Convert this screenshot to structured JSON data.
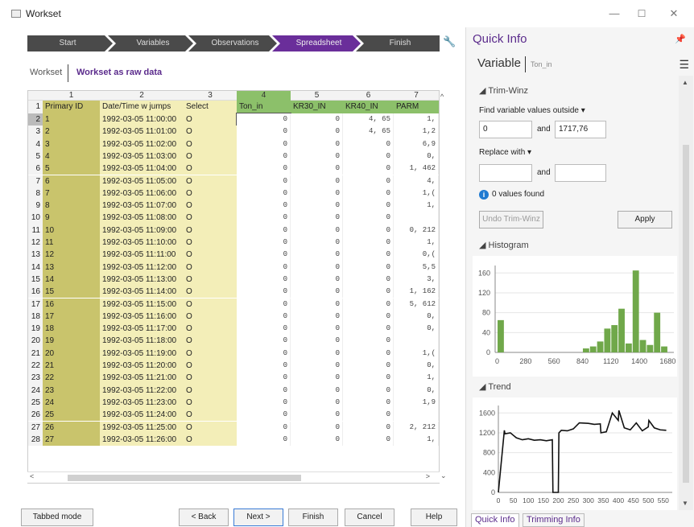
{
  "window": {
    "title": "Workset"
  },
  "wizard": {
    "steps": [
      "Start",
      "Variables",
      "Observations",
      "Spreadsheet",
      "Finish"
    ],
    "active": 3
  },
  "tabs": {
    "workset": "Workset",
    "raw": "Workset as raw data"
  },
  "grid": {
    "col_numbers": [
      "1",
      "2",
      "3",
      "4",
      "5",
      "6",
      "7"
    ],
    "headers": [
      "Primary ID",
      "Date/Time w jumps",
      "Select",
      "Ton_in",
      "KR30_IN",
      "KR40_IN",
      "PARM"
    ],
    "rows": [
      {
        "n": "2",
        "id": "1",
        "dt": "1992-03-05 11:00:00",
        "sel": "O",
        "ton": "0",
        "kr30": "0",
        "kr40": "4, 65",
        "parm": "1,"
      },
      {
        "n": "3",
        "id": "2",
        "dt": "1992-03-05 11:01:00",
        "sel": "O",
        "ton": "0",
        "kr30": "0",
        "kr40": "4, 65",
        "parm": "1,2"
      },
      {
        "n": "4",
        "id": "3",
        "dt": "1992-03-05 11:02:00",
        "sel": "O",
        "ton": "0",
        "kr30": "0",
        "kr40": "0",
        "parm": "6,9"
      },
      {
        "n": "5",
        "id": "4",
        "dt": "1992-03-05 11:03:00",
        "sel": "O",
        "ton": "0",
        "kr30": "0",
        "kr40": "0",
        "parm": "0,"
      },
      {
        "n": "6",
        "id": "5",
        "dt": "1992-03-05 11:04:00",
        "sel": "O",
        "ton": "0",
        "kr30": "0",
        "kr40": "0",
        "parm": "1, 462"
      },
      {
        "n": "7",
        "id": "6",
        "dt": "1992-03-05 11:05:00",
        "sel": "O",
        "ton": "0",
        "kr30": "0",
        "kr40": "0",
        "parm": "4,"
      },
      {
        "n": "8",
        "id": "7",
        "dt": "1992-03-05 11:06:00",
        "sel": "O",
        "ton": "0",
        "kr30": "0",
        "kr40": "0",
        "parm": "1,("
      },
      {
        "n": "9",
        "id": "8",
        "dt": "1992-03-05 11:07:00",
        "sel": "O",
        "ton": "0",
        "kr30": "0",
        "kr40": "0",
        "parm": "1,"
      },
      {
        "n": "10",
        "id": "9",
        "dt": "1992-03-05 11:08:00",
        "sel": "O",
        "ton": "0",
        "kr30": "0",
        "kr40": "0",
        "parm": ""
      },
      {
        "n": "11",
        "id": "10",
        "dt": "1992-03-05 11:09:00",
        "sel": "O",
        "ton": "0",
        "kr30": "0",
        "kr40": "0",
        "parm": "0, 212"
      },
      {
        "n": "12",
        "id": "11",
        "dt": "1992-03-05 11:10:00",
        "sel": "O",
        "ton": "0",
        "kr30": "0",
        "kr40": "0",
        "parm": "1,"
      },
      {
        "n": "13",
        "id": "12",
        "dt": "1992-03-05 11:11:00",
        "sel": "O",
        "ton": "0",
        "kr30": "0",
        "kr40": "0",
        "parm": "0,("
      },
      {
        "n": "14",
        "id": "13",
        "dt": "1992-03-05 11:12:00",
        "sel": "O",
        "ton": "0",
        "kr30": "0",
        "kr40": "0",
        "parm": "5,5"
      },
      {
        "n": "15",
        "id": "14",
        "dt": "1992-03-05 11:13:00",
        "sel": "O",
        "ton": "0",
        "kr30": "0",
        "kr40": "0",
        "parm": "3,"
      },
      {
        "n": "16",
        "id": "15",
        "dt": "1992-03-05 11:14:00",
        "sel": "O",
        "ton": "0",
        "kr30": "0",
        "kr40": "0",
        "parm": "1, 162"
      },
      {
        "n": "17",
        "id": "16",
        "dt": "1992-03-05 11:15:00",
        "sel": "O",
        "ton": "0",
        "kr30": "0",
        "kr40": "0",
        "parm": "5, 612"
      },
      {
        "n": "18",
        "id": "17",
        "dt": "1992-03-05 11:16:00",
        "sel": "O",
        "ton": "0",
        "kr30": "0",
        "kr40": "0",
        "parm": "0,"
      },
      {
        "n": "19",
        "id": "18",
        "dt": "1992-03-05 11:17:00",
        "sel": "O",
        "ton": "0",
        "kr30": "0",
        "kr40": "0",
        "parm": "0,"
      },
      {
        "n": "20",
        "id": "19",
        "dt": "1992-03-05 11:18:00",
        "sel": "O",
        "ton": "0",
        "kr30": "0",
        "kr40": "0",
        "parm": ""
      },
      {
        "n": "21",
        "id": "20",
        "dt": "1992-03-05 11:19:00",
        "sel": "O",
        "ton": "0",
        "kr30": "0",
        "kr40": "0",
        "parm": "1,("
      },
      {
        "n": "22",
        "id": "21",
        "dt": "1992-03-05 11:20:00",
        "sel": "O",
        "ton": "0",
        "kr30": "0",
        "kr40": "0",
        "parm": "0,"
      },
      {
        "n": "23",
        "id": "22",
        "dt": "1992-03-05 11:21:00",
        "sel": "O",
        "ton": "0",
        "kr30": "0",
        "kr40": "0",
        "parm": "1,"
      },
      {
        "n": "24",
        "id": "23",
        "dt": "1992-03-05 11:22:00",
        "sel": "O",
        "ton": "0",
        "kr30": "0",
        "kr40": "0",
        "parm": "0,"
      },
      {
        "n": "25",
        "id": "24",
        "dt": "1992-03-05 11:23:00",
        "sel": "O",
        "ton": "0",
        "kr30": "0",
        "kr40": "0",
        "parm": "1,9"
      },
      {
        "n": "26",
        "id": "25",
        "dt": "1992-03-05 11:24:00",
        "sel": "O",
        "ton": "0",
        "kr30": "0",
        "kr40": "0",
        "parm": ""
      },
      {
        "n": "27",
        "id": "26",
        "dt": "1992-03-05 11:25:00",
        "sel": "O",
        "ton": "0",
        "kr30": "0",
        "kr40": "0",
        "parm": "2, 212"
      },
      {
        "n": "28",
        "id": "27",
        "dt": "1992-03-05 11:26:00",
        "sel": "O",
        "ton": "0",
        "kr30": "0",
        "kr40": "0",
        "parm": "1,"
      }
    ]
  },
  "buttons": {
    "tabbed": "Tabbed mode",
    "back": "< Back",
    "next": "Next >",
    "finish": "Finish",
    "cancel": "Cancel",
    "help": "Help"
  },
  "quickinfo": {
    "title": "Quick Info",
    "variable_label": "Variable",
    "variable_name": "Ton_in",
    "trim": {
      "title": "Trim-Winz",
      "find_label": "Find variable values outside",
      "low": "0",
      "and1": "and",
      "high": "1717,76",
      "replace_label": "Replace with",
      "and2": "and",
      "found": "0 values found",
      "undo": "Undo Trim-Winz",
      "apply": "Apply"
    },
    "histogram_title": "Histogram",
    "trend_title": "Trend",
    "tabs": [
      "Quick Info",
      "Trimming Info"
    ]
  },
  "colors": {
    "accent": "#5b2b8c",
    "bar": "#70a84a",
    "step_bg": "#4a4a4a",
    "step_active": "#6a2e9a",
    "id_col": "#c9c46c",
    "dt_col": "#f3eeb8",
    "header_green": "#8cc06a"
  },
  "chart_data": [
    {
      "type": "bar",
      "title": "Histogram",
      "x_ticks": [
        0,
        280,
        560,
        840,
        1120,
        1400,
        1680
      ],
      "y_ticks": [
        0,
        40,
        80,
        120,
        160
      ],
      "xlim": [
        -20,
        1740
      ],
      "ylim": [
        0,
        175
      ],
      "bins": [
        {
          "x0": 0,
          "x1": 70,
          "y": 65
        },
        {
          "x0": 840,
          "x1": 910,
          "y": 8
        },
        {
          "x0": 910,
          "x1": 980,
          "y": 12
        },
        {
          "x0": 980,
          "x1": 1050,
          "y": 22
        },
        {
          "x0": 1050,
          "x1": 1120,
          "y": 48
        },
        {
          "x0": 1120,
          "x1": 1190,
          "y": 55
        },
        {
          "x0": 1190,
          "x1": 1260,
          "y": 88
        },
        {
          "x0": 1260,
          "x1": 1330,
          "y": 18
        },
        {
          "x0": 1330,
          "x1": 1400,
          "y": 165
        },
        {
          "x0": 1400,
          "x1": 1470,
          "y": 25
        },
        {
          "x0": 1470,
          "x1": 1540,
          "y": 15
        },
        {
          "x0": 1540,
          "x1": 1610,
          "y": 80
        },
        {
          "x0": 1610,
          "x1": 1680,
          "y": 12
        }
      ]
    },
    {
      "type": "line",
      "title": "Trend",
      "x_ticks": [
        0,
        50,
        100,
        150,
        200,
        250,
        300,
        350,
        400,
        450,
        500,
        550
      ],
      "y_ticks": [
        0,
        400,
        800,
        1200,
        1600
      ],
      "xlim": [
        0,
        580
      ],
      "ylim": [
        0,
        1750
      ],
      "series": [
        {
          "x": [
            0,
            20,
            22,
            40,
            60,
            80,
            100,
            120,
            140,
            160,
            180,
            182,
            200,
            202,
            210,
            230,
            250,
            270,
            300,
            320,
            340,
            342,
            360,
            380,
            400,
            402,
            420,
            440,
            460,
            480,
            500,
            502,
            520,
            540,
            560
          ],
          "y": [
            0,
            1250,
            1180,
            1200,
            1100,
            1060,
            1080,
            1050,
            1060,
            1040,
            1060,
            0,
            0,
            1200,
            1250,
            1240,
            1280,
            1400,
            1390,
            1370,
            1380,
            1200,
            1220,
            1600,
            1450,
            1650,
            1300,
            1260,
            1400,
            1240,
            1320,
            1450,
            1300,
            1260,
            1250
          ]
        }
      ]
    }
  ]
}
